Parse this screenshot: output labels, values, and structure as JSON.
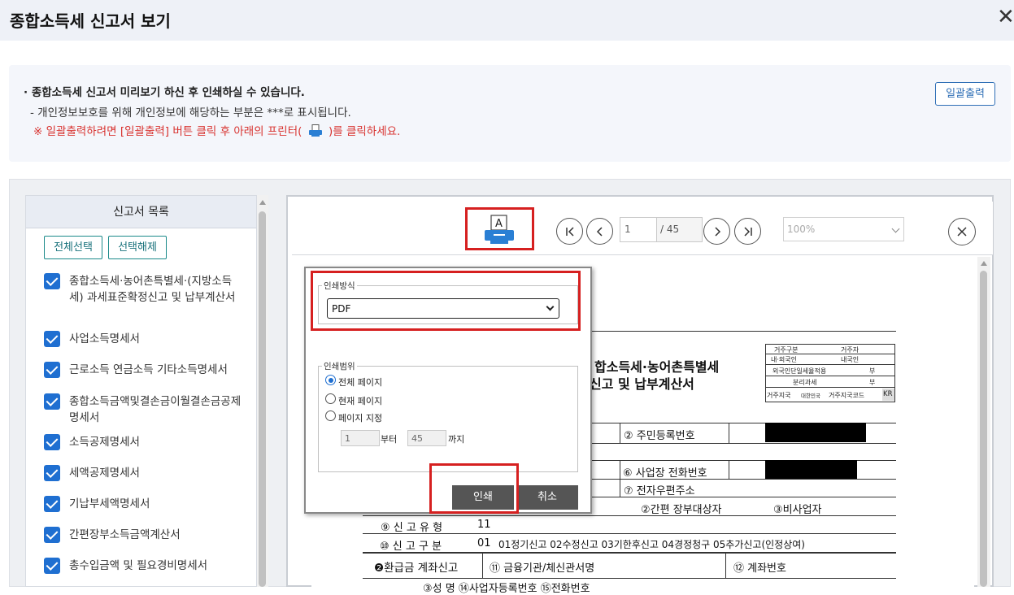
{
  "window": {
    "title": "종합소득세 신고서 보기",
    "close_glyph": "✕"
  },
  "notice": {
    "line1": "· 종합소득세 신고서 미리보기 하신 후 인쇄하실 수 있습니다.",
    "line2": "- 개인정보보호를 위해 개인정보에 해당하는 부분은  ***로 표시됩니다.",
    "line3_before": "※ 일괄출력하려면 [일괄출력] 버튼 클릭 후 아래의 프린터(",
    "line3_after": ")를 클릭하세요.",
    "batch_button": "일괄출력"
  },
  "sidebar": {
    "header": "신고서 목록",
    "select_all": "전체선택",
    "deselect_all": "선택해제",
    "items": [
      {
        "label": "종합소득세·농어촌특별세·(지방소득세) 과세표준확정신고 및 납부계산서",
        "checked": true
      },
      {
        "label": "사업소득명세서",
        "checked": true
      },
      {
        "label": "근로소득 연금소득 기타소득명세서",
        "checked": true
      },
      {
        "label": "종합소득금액및결손금이월결손금공제명세서",
        "checked": true
      },
      {
        "label": "소득공제명세서",
        "checked": true
      },
      {
        "label": "세액공제명세서",
        "checked": true
      },
      {
        "label": "기납부세액명세서",
        "checked": true
      },
      {
        "label": "간편장부소득금액계산서",
        "checked": true
      },
      {
        "label": "총수입금액 및 필요경비명세서",
        "checked": true
      }
    ]
  },
  "viewer": {
    "printer_icon_letter": "A",
    "current_page": "1",
    "total_pages": "/ 45",
    "zoom": "100%"
  },
  "print_dialog": {
    "method_legend": "인쇄방식",
    "method_value": "PDF",
    "range_legend": "인쇄범위",
    "options": [
      {
        "label": "전체 페이지",
        "selected": true
      },
      {
        "label": "현재 페이지",
        "selected": false
      },
      {
        "label": "페이지 지정",
        "selected": false
      }
    ],
    "from_value": "1",
    "from_suffix": "부터",
    "to_value": "45",
    "to_suffix": "까지",
    "print_button": "인쇄",
    "cancel_button": "취소"
  },
  "document": {
    "title_l1": "합소득세·농어촌특별세",
    "title_l2": "신고 및 납부계산서",
    "res_table": [
      [
        "거주구분",
        "거주자"
      ],
      [
        "내·외국인",
        "내국인"
      ],
      [
        "외국인단일세율적용",
        "부"
      ],
      [
        "분리과세",
        "부"
      ]
    ],
    "res_last": [
      "거주지국",
      "대한민국",
      "거주지국코드",
      "KR"
    ],
    "rows": {
      "resident_id": "② 주민등록번호",
      "business_phone": "⑥ 사업장 전화번호",
      "email": "⑦ 전자우편주소",
      "simple_book": "②간편 장부대상자",
      "non_business": "③비사업자",
      "filing_type_label": "⑨ 신 고 유 형",
      "filing_type_code": "11",
      "filing_class_label": "⑩ 신 고 구 분",
      "filing_class_code": "01",
      "filing_class_options": "01정기신고  02수정신고  03기한후신고  04경정청구  05추가신고(인정상여)",
      "refund_label": "❷환급금 계좌신고",
      "bank_label": "⑪ 금융기관/체신관서명",
      "account_label": "⑫ 계좌번호",
      "bottom_row": "③성 명      ⑭사업자등록번호              ⑮전화번호"
    }
  }
}
